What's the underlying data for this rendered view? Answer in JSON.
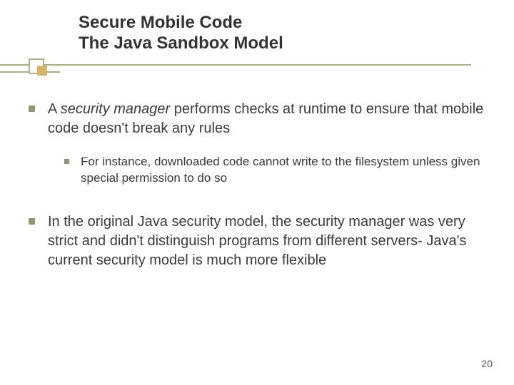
{
  "title": {
    "line1": "Secure Mobile Code",
    "line2": "The Java Sandbox Model"
  },
  "bullets": {
    "b1_pre": "A ",
    "b1_em": "security manager",
    "b1_post": " performs checks at runtime to ensure that mobile code doesn't break any rules",
    "b1_sub1": "For instance, downloaded code cannot write to the filesystem unless given special permission to do so",
    "b2": "In the original Java security model, the security manager was very strict and didn't distinguish programs from different servers- Java's current security model is much more flexible"
  },
  "pageNumber": "20"
}
